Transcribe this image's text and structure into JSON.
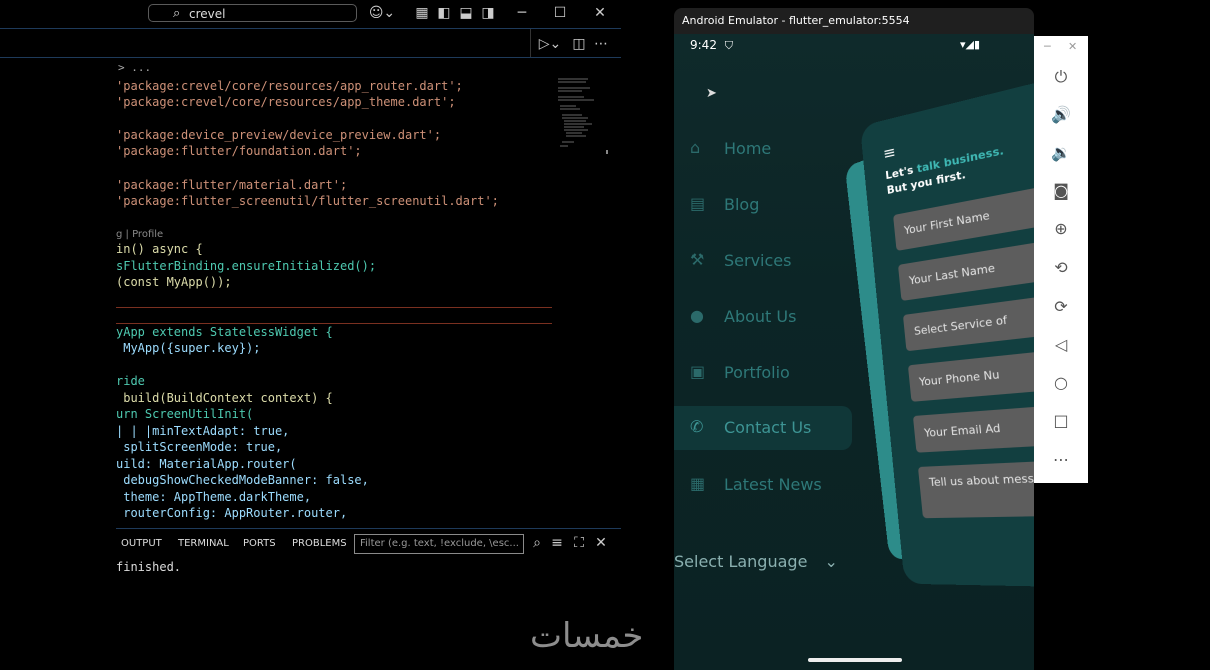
{
  "vscode": {
    "search": "crevel",
    "breadcrumb": "> ...",
    "code_lines": [
      {
        "t": "'package:crevel/core/resources/app_router.dart';"
      },
      {
        "t": "'package:crevel/core/resources/app_theme.dart';"
      },
      {
        "t": "'package:device_preview/device_preview.dart';"
      },
      {
        "t": "'package:flutter/foundation.dart';"
      },
      {
        "t": "'package:flutter/material.dart';"
      },
      {
        "t": "'package:flutter_screenutil/flutter_screenutil.dart';"
      },
      {
        "t": "g | Profile"
      },
      {
        "t": "in() async {"
      },
      {
        "t": "sFlutterBinding.ensureInitialized();"
      },
      {
        "t": "(const MyApp());"
      },
      {
        "t": "yApp extends StatelessWidget {"
      },
      {
        "t": " MyApp({super.key});"
      },
      {
        "t": "ride"
      },
      {
        "t": " build(BuildContext context) {"
      },
      {
        "t": "urn ScreenUtilInit("
      },
      {
        "t": "| | |minTextAdapt: true,"
      },
      {
        "t": " splitScreenMode: true,"
      },
      {
        "t": "uild: MaterialApp.router("
      },
      {
        "t": " debugShowCheckedModeBanner: false,"
      },
      {
        "t": " theme: AppTheme.darkTheme,"
      },
      {
        "t": " routerConfig: AppRouter.router,"
      }
    ],
    "panel_tabs": [
      "OUTPUT",
      "TERMINAL",
      "PORTS",
      "PROBLEMS"
    ],
    "filter_placeholder": "Filter (e.g. text, !exclude, \\esc...",
    "terminal_output": "finished."
  },
  "emulator": {
    "title": "Android Emulator - flutter_emulator:5554",
    "time": "9:42",
    "nav": [
      {
        "label": "Home",
        "icon": "home-icon"
      },
      {
        "label": "Blog",
        "icon": "book-icon"
      },
      {
        "label": "Services",
        "icon": "wrench-icon"
      },
      {
        "label": "About Us",
        "icon": "info-icon"
      },
      {
        "label": "Portfolio",
        "icon": "briefcase-icon"
      },
      {
        "label": "Contact Us",
        "icon": "phone-icon"
      },
      {
        "label": "Latest News",
        "icon": "news-icon"
      }
    ],
    "active_nav": "Contact Us",
    "select_language": "Select Language",
    "card": {
      "title_a": "Let's ",
      "title_hl": "talk business.",
      "title_b": "But you first.",
      "fields": [
        "Your First Name",
        "Your Last Name",
        "Select Service of",
        "Your Phone Nu",
        "Your Email Ad",
        "Tell us about message..."
      ]
    },
    "toolbar_icons": [
      "power-icon",
      "volume-up-icon",
      "volume-down-icon",
      "camera-icon",
      "zoom-icon",
      "rotate-left-icon",
      "rotate-right-icon",
      "back-icon",
      "home-circle-icon",
      "overview-icon",
      "more-icon"
    ]
  },
  "watermark": "خمسات"
}
